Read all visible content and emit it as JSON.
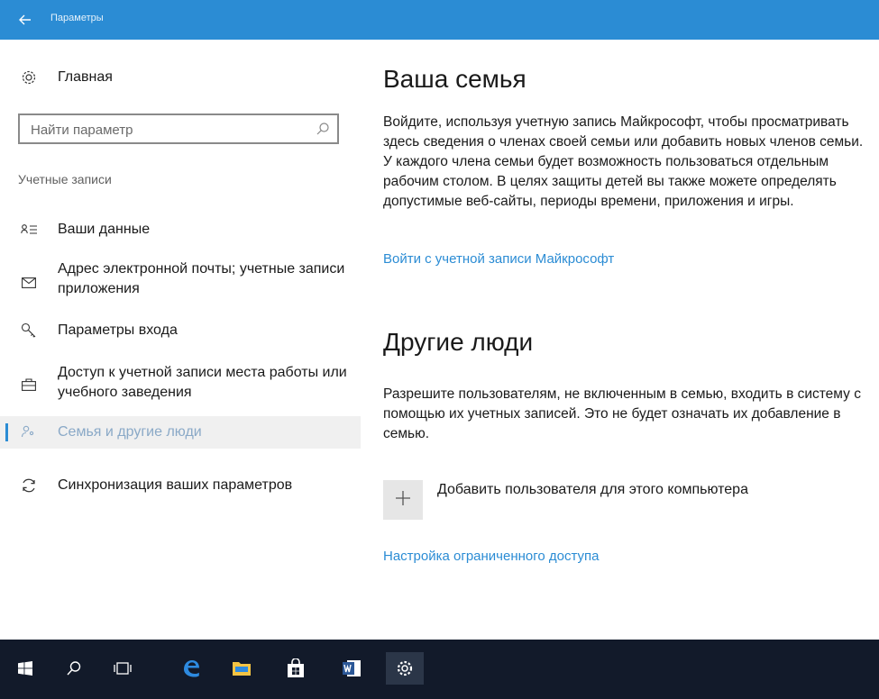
{
  "window": {
    "title": "Параметры",
    "back_icon": "back-arrow-icon",
    "accent_color": "#2b8cd4"
  },
  "sidebar": {
    "home": {
      "label": "Главная",
      "icon": "gear-icon"
    },
    "search": {
      "placeholder": "Найти параметр",
      "value": "",
      "icon": "search-icon"
    },
    "section_title": "Учетные записи",
    "items": [
      {
        "label": "Ваши данные",
        "icon": "person-card-icon",
        "active": false
      },
      {
        "label": "Адрес электронной почты; учетные записи приложения",
        "icon": "mail-icon",
        "active": false
      },
      {
        "label": "Параметры входа",
        "icon": "key-icon",
        "active": false
      },
      {
        "label": "Доступ к учетной записи места работы или учебного заведения",
        "icon": "briefcase-icon",
        "active": false
      },
      {
        "label": "Семья и другие люди",
        "icon": "family-icon",
        "active": true
      },
      {
        "label": "Синхронизация ваших параметров",
        "icon": "sync-icon",
        "active": false
      }
    ]
  },
  "main": {
    "family": {
      "heading": "Ваша семья",
      "description": "Войдите, используя учетную запись Майкрософт, чтобы просматривать здесь сведения о членах своей семьи или добавить новых членов семьи. У каждого члена семьи будет возможность пользоваться отдельным рабочим столом. В целях защиты детей вы также можете определять допустимые веб-сайты, периоды времени, приложения и игры.",
      "signin_link": "Войти с учетной записи Майкрософт"
    },
    "other_people": {
      "heading": "Другие люди",
      "description": "Разрешите пользователям, не включенным в семью, входить в систему с помощью их учетных записей. Это не будет означать их добавление в семью.",
      "add_user_label": "Добавить пользователя для этого компьютера",
      "add_user_icon": "plus-icon",
      "kiosk_link": "Настройка ограниченного доступа"
    }
  },
  "taskbar": {
    "items": [
      {
        "icon": "windows-start-icon"
      },
      {
        "icon": "search-icon"
      },
      {
        "icon": "task-view-icon"
      },
      {
        "icon": "edge-browser-icon"
      },
      {
        "icon": "file-explorer-icon"
      },
      {
        "icon": "store-icon"
      },
      {
        "icon": "word-icon"
      },
      {
        "icon": "settings-gear-icon",
        "active": true
      }
    ]
  }
}
